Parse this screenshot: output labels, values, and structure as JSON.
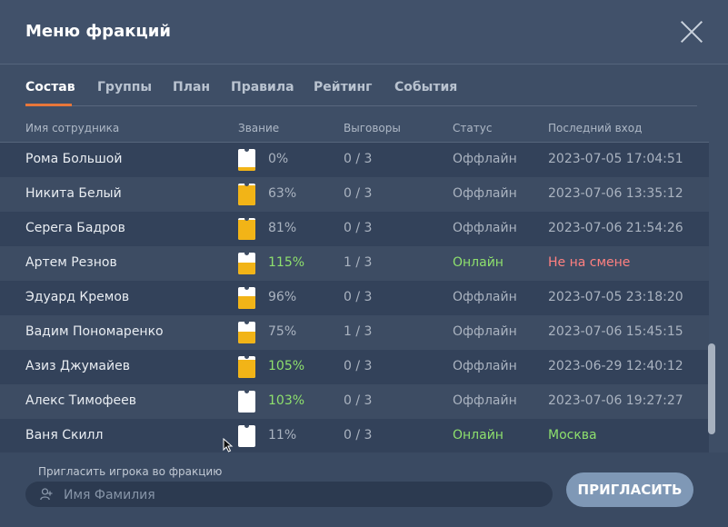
{
  "window": {
    "title": "Меню фракций"
  },
  "tabs": [
    {
      "label": "Состав",
      "active": true
    },
    {
      "label": "Группы",
      "active": false
    },
    {
      "label": "План",
      "active": false
    },
    {
      "label": "Правила",
      "active": false
    },
    {
      "label": "Рейтинг",
      "active": false
    },
    {
      "label": "События",
      "active": false
    }
  ],
  "columns": {
    "name": "Имя сотрудника",
    "rank": "Звание",
    "warnings": "Выговоры",
    "status": "Статус",
    "last_login": "Последний вход"
  },
  "rows": [
    {
      "name": "Рома Большой",
      "rank_progress": "0%",
      "warnings": "0 / 3",
      "status": "Оффлайн",
      "last": "2023-07-05 17:04:51",
      "rank_fill": 0.15,
      "pct_color": "normal",
      "status_color": "normal",
      "last_color": "normal"
    },
    {
      "name": "Никита Белый",
      "rank_progress": "63%",
      "warnings": "0 / 3",
      "status": "Оффлайн",
      "last": "2023-07-06 13:35:12",
      "rank_fill": 0.9,
      "pct_color": "normal",
      "status_color": "normal",
      "last_color": "normal"
    },
    {
      "name": "Серега Бадров",
      "rank_progress": "81%",
      "warnings": "0 / 3",
      "status": "Оффлайн",
      "last": "2023-07-06 21:54:26",
      "rank_fill": 0.9,
      "pct_color": "normal",
      "status_color": "normal",
      "last_color": "normal"
    },
    {
      "name": "Артем Резнов",
      "rank_progress": "115%",
      "warnings": "1 / 3",
      "status": "Онлайн",
      "last": "Не на смене",
      "rank_fill": 0.55,
      "pct_color": "green",
      "status_color": "green",
      "last_color": "red"
    },
    {
      "name": "Эдуард Кремов",
      "rank_progress": "96%",
      "warnings": "0 / 3",
      "status": "Оффлайн",
      "last": "2023-07-05 23:18:20",
      "rank_fill": 0.6,
      "pct_color": "normal",
      "status_color": "normal",
      "last_color": "normal"
    },
    {
      "name": "Вадим Пономаренко",
      "rank_progress": "75%",
      "warnings": "1 / 3",
      "status": "Оффлайн",
      "last": "2023-07-06 15:45:15",
      "rank_fill": 0.55,
      "pct_color": "normal",
      "status_color": "normal",
      "last_color": "normal"
    },
    {
      "name": "Азиз Джумайев",
      "rank_progress": "105%",
      "warnings": "0 / 3",
      "status": "Оффлайн",
      "last": "2023-06-29 12:40:12",
      "rank_fill": 0.85,
      "pct_color": "green",
      "status_color": "normal",
      "last_color": "normal"
    },
    {
      "name": "Алекс Тимофеев",
      "rank_progress": "103%",
      "warnings": "0 / 3",
      "status": "Оффлайн",
      "last": "2023-07-06 19:27:27",
      "rank_fill": 0.0,
      "pct_color": "green",
      "status_color": "normal",
      "last_color": "normal"
    },
    {
      "name": "Ваня Скилл",
      "rank_progress": "11%",
      "warnings": "0 / 3",
      "status": "Онлайн",
      "last": "Москва",
      "rank_fill": 0.0,
      "pct_color": "normal",
      "status_color": "green",
      "last_color": "green"
    }
  ],
  "invite": {
    "label": "Пригласить игрока во фракцию",
    "placeholder": "Имя Фамилия",
    "button": "ПРИГЛАСИТЬ"
  },
  "colors": {
    "accent_tab": "#e8763a",
    "online": "#8ee06d",
    "off_shift": "#ff8080",
    "rank_fill": "#f2b417"
  }
}
